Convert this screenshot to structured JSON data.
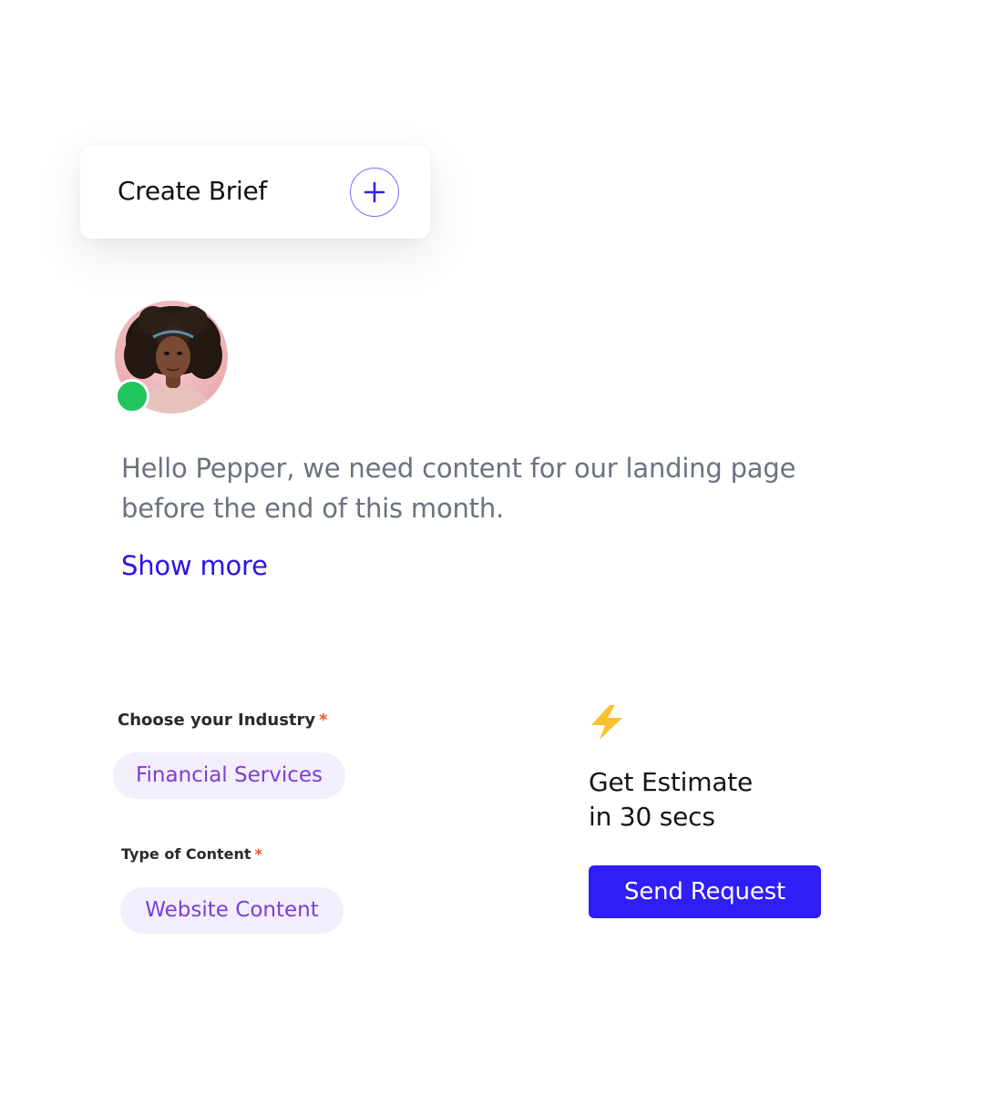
{
  "brief_card": {
    "title": "Create Brief",
    "add_icon": "plus-icon",
    "accent_color": "#2f1ef5"
  },
  "avatar": {
    "status": "online",
    "status_color": "#21c45d"
  },
  "message": {
    "text": "Hello Pepper, we need content for our landing page before the end of this month.",
    "show_more_label": "Show more"
  },
  "form": {
    "industry": {
      "label": "Choose your Industry",
      "required_mark": "*",
      "selected_value": "Financial Services"
    },
    "content_type": {
      "label": "Type of Content",
      "required_mark": "*",
      "selected_value": "Website Content"
    }
  },
  "estimate": {
    "icon": "lightning-bolt-icon",
    "title_line1": "Get Estimate",
    "title_line2": "in 30 secs",
    "button_label": "Send Request",
    "button_color": "#2f1ef5"
  }
}
